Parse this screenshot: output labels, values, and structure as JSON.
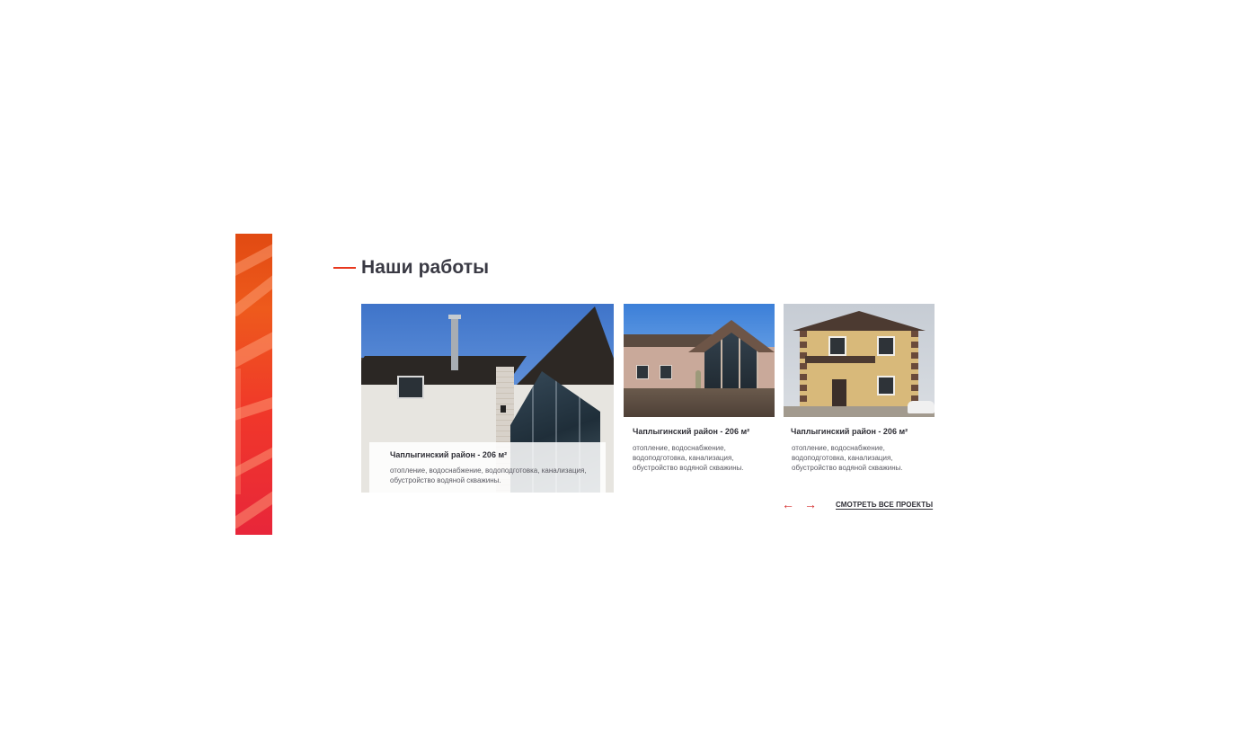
{
  "section": {
    "title": "Наши работы"
  },
  "projects": [
    {
      "title": "Чаплыгинский район - 206 м²",
      "description": "отопление, водоснабжение, водоподготовка, канализация, обустройство водяной скважины."
    },
    {
      "title": "Чаплыгинский район - 206 м²",
      "description": "отопление, водоснабжение, водоподготовка, канализация, обустройство водяной скважины."
    },
    {
      "title": "Чаплыгинский район - 206 м²",
      "description": "отопление, водоснабжение, водоподготовка, канализация, обустройство водяной скважины."
    }
  ],
  "navigation": {
    "prev_icon": "←",
    "next_icon": "→",
    "all_projects_label": "СМОТРЕТЬ ВСЕ ПРОЕКТЫ"
  },
  "colors": {
    "accent": "#e8381e",
    "arrow": "#d52f2f",
    "text_dark": "#2f2f36",
    "text_muted": "#5a5a62"
  }
}
